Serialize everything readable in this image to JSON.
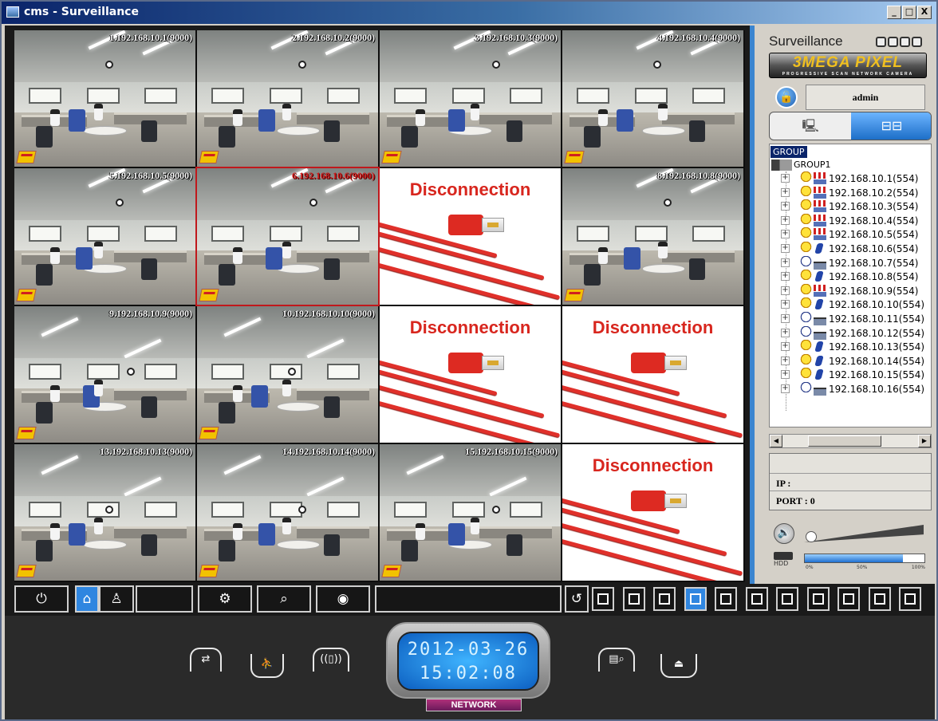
{
  "window": {
    "title": "cms - Surveillance",
    "min": "_",
    "max": "□",
    "close": "X"
  },
  "cameras": [
    {
      "label": "1.192.168.10.1(9000)",
      "state": "live"
    },
    {
      "label": "2.192.168.10.2(9000)",
      "state": "live"
    },
    {
      "label": "3.192.168.10.3(9000)",
      "state": "live"
    },
    {
      "label": "4.192.168.10.4(9000)",
      "state": "live"
    },
    {
      "label": "5.192.168.10.5(9000)",
      "state": "live"
    },
    {
      "label": "6.192.168.10.6(9000)",
      "state": "selected"
    },
    {
      "label": "Disconnection",
      "state": "disconnected"
    },
    {
      "label": "8.192.168.10.8(9000)",
      "state": "live"
    },
    {
      "label": "9.192.168.10.9(9000)",
      "state": "live"
    },
    {
      "label": "10.192.168.10.10(9000)",
      "state": "live"
    },
    {
      "label": "Disconnection",
      "state": "disconnected"
    },
    {
      "label": "Disconnection",
      "state": "disconnected"
    },
    {
      "label": "13.192.168.10.13(9000)",
      "state": "live"
    },
    {
      "label": "14.192.168.10.14(9000)",
      "state": "live"
    },
    {
      "label": "15.192.168.10.15(9000)",
      "state": "live"
    },
    {
      "label": "Disconnection",
      "state": "disconnected"
    }
  ],
  "sidebar": {
    "title": "Surveillance",
    "logo": "3MEGA PIXEL",
    "logo_sub": "PROGRESSIVE SCAN   NETWORK CAMERA",
    "user": "admin",
    "tree_header": "GROUP",
    "group": "GROUP1",
    "devices": [
      {
        "ip": "192.168.10.1(554)",
        "status": "arrow",
        "cam": "on"
      },
      {
        "ip": "192.168.10.2(554)",
        "status": "arrow",
        "cam": "on"
      },
      {
        "ip": "192.168.10.3(554)",
        "status": "arrow",
        "cam": "on"
      },
      {
        "ip": "192.168.10.4(554)",
        "status": "arrow",
        "cam": "on"
      },
      {
        "ip": "192.168.10.5(554)",
        "status": "arrow",
        "cam": "on"
      },
      {
        "ip": "192.168.10.6(554)",
        "status": "run",
        "cam": "on"
      },
      {
        "ip": "192.168.10.7(554)",
        "status": "none",
        "cam": "off"
      },
      {
        "ip": "192.168.10.8(554)",
        "status": "run",
        "cam": "on"
      },
      {
        "ip": "192.168.10.9(554)",
        "status": "arrow",
        "cam": "on"
      },
      {
        "ip": "192.168.10.10(554)",
        "status": "run",
        "cam": "on"
      },
      {
        "ip": "192.168.10.11(554)",
        "status": "none",
        "cam": "off"
      },
      {
        "ip": "192.168.10.12(554)",
        "status": "none",
        "cam": "off"
      },
      {
        "ip": "192.168.10.13(554)",
        "status": "run",
        "cam": "on"
      },
      {
        "ip": "192.168.10.14(554)",
        "status": "run",
        "cam": "on"
      },
      {
        "ip": "192.168.10.15(554)",
        "status": "run",
        "cam": "on"
      },
      {
        "ip": "192.168.10.16(554)",
        "status": "none",
        "cam": "off"
      }
    ],
    "ip_label": "IP :",
    "port_label": "PORT : 0",
    "hdd_label": "HDD",
    "hdd_ticks": [
      "0%",
      "50%",
      "100%"
    ],
    "hdd_usage": 0.82
  },
  "toolbar": {
    "power": "⏻",
    "home": "⌂",
    "user": "♙",
    "settings": "⚙",
    "search": "⌕",
    "globe": "◉",
    "refresh": "↺",
    "layouts": [
      "1",
      "4",
      "9",
      "16",
      "6",
      "8",
      "10",
      "13",
      "single",
      "full",
      "alt"
    ],
    "active_layout": "16"
  },
  "bottom": {
    "rotate": "⇄",
    "run": "⛹",
    "alarm": "((▯))",
    "playback": "▤⌕",
    "record": "⏏",
    "date": "2012-03-26",
    "time": "15:02:08",
    "network": "NETWORK"
  },
  "colors": {
    "accent": "#2f86e0",
    "disconnect": "#d8261e",
    "selected": "#c0181c"
  }
}
